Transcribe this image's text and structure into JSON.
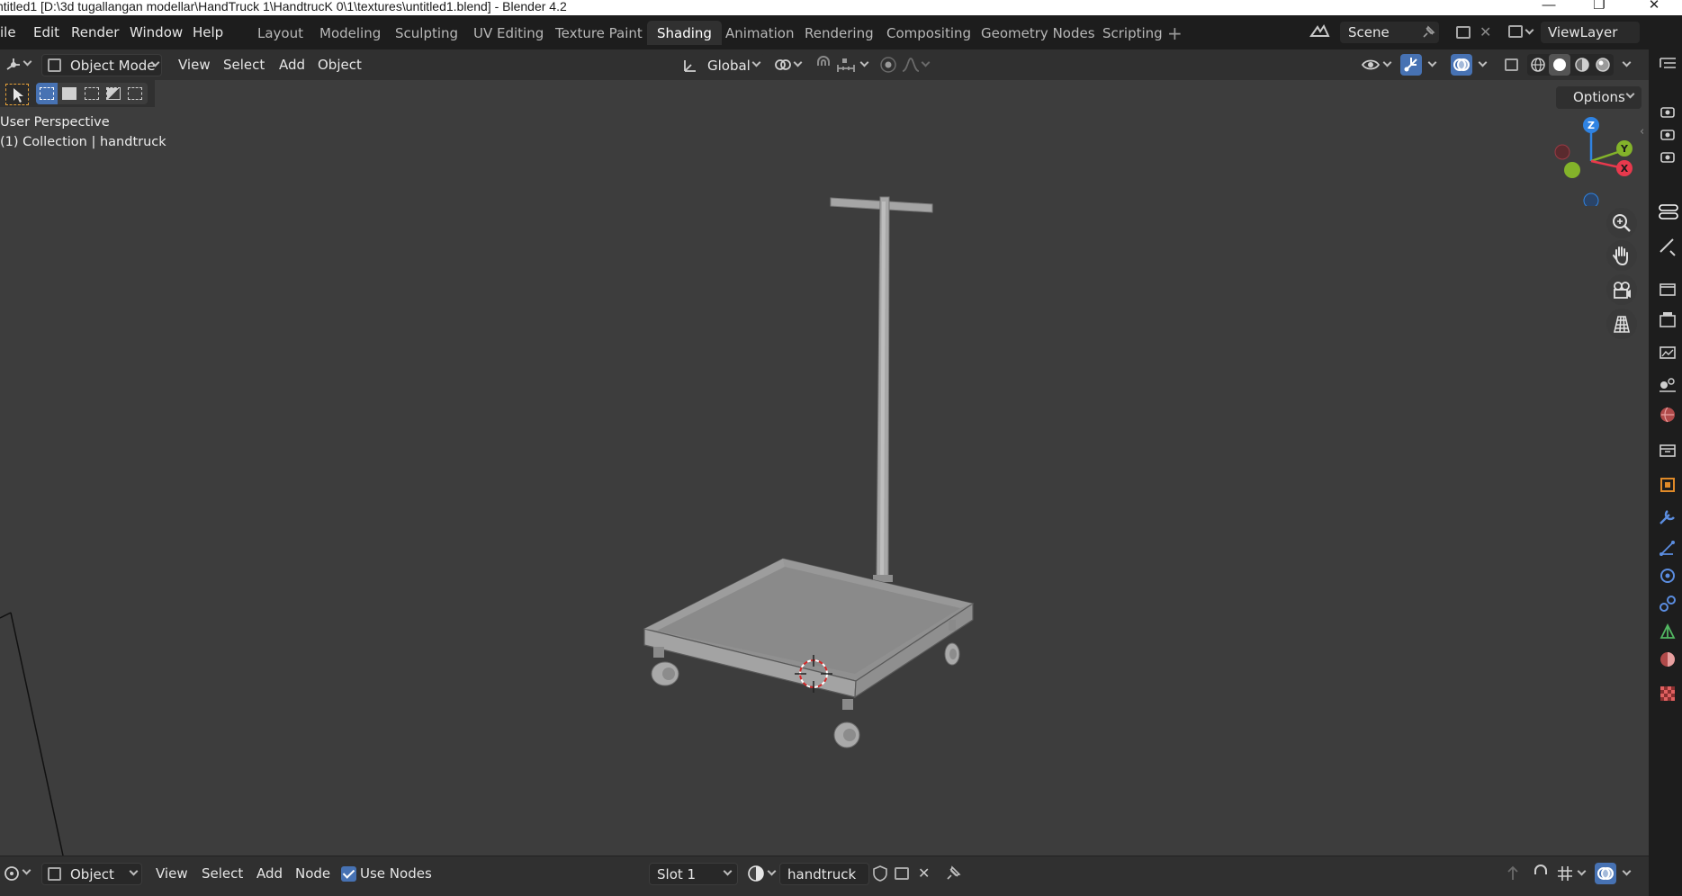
{
  "window": {
    "title": "ntitled1 [D:\\3d tugallangan modellar\\HandTruck 1\\HandtrucK 0\\1\\textures\\untitled1.blend] - Blender 4.2",
    "minimize_glyph": "—",
    "restore_glyph": "❐",
    "close_glyph": "✕"
  },
  "menu": {
    "file": "ile",
    "edit": "Edit",
    "render": "Render",
    "window": "Window",
    "help": "Help"
  },
  "workspaces": {
    "layout": "Layout",
    "modeling": "Modeling",
    "sculpting": "Sculpting",
    "uv_editing": "UV Editing",
    "texture_paint": "Texture Paint",
    "shading": "Shading",
    "animation": "Animation",
    "rendering": "Rendering",
    "compositing": "Compositing",
    "geometry_nodes": "Geometry Nodes",
    "scripting": "Scripting",
    "add_glyph": "+"
  },
  "scene": {
    "name": "Scene",
    "view_layer": "ViewLayer"
  },
  "viewport_header": {
    "mode": "Object Mode",
    "view": "View",
    "select": "Select",
    "add": "Add",
    "object": "Object",
    "orientation": "Global"
  },
  "viewport": {
    "perspective_label": "User Perspective",
    "collection_label": "(1) Collection | handtruck",
    "options_label": "Options",
    "axis_z": "Z",
    "axis_y": "Y",
    "axis_x": "X"
  },
  "bottom_header": {
    "editor_mode": "Object",
    "view": "View",
    "select": "Select",
    "add": "Add",
    "node": "Node",
    "use_nodes_label": "Use Nodes",
    "use_nodes_checked": true,
    "slot": "Slot 1",
    "material_name": "handtruck"
  },
  "colors": {
    "accent_blue": "#4772b3",
    "axis_x": "#e8394d",
    "axis_y": "#83b32a",
    "axis_z": "#2f83e3",
    "object_orange": "#e08a28"
  }
}
